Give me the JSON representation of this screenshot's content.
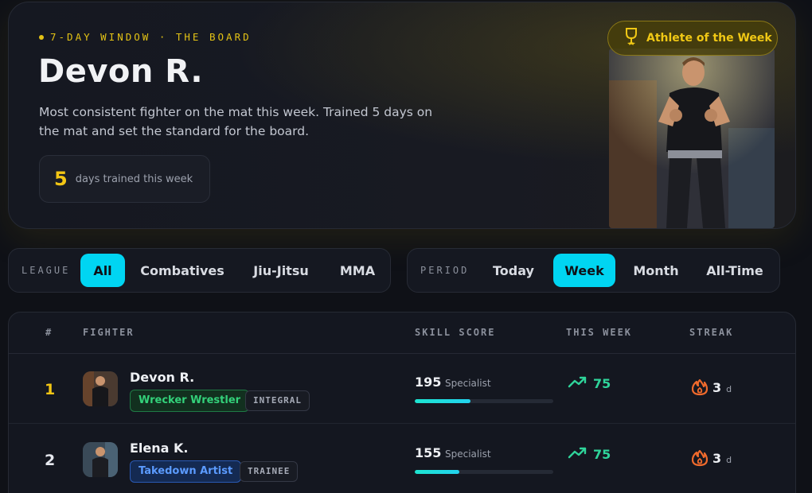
{
  "hero": {
    "eyebrow": "7-DAY WINDOW · THE BOARD",
    "name": "Devon R.",
    "description": "Most consistent fighter on the mat this week. Trained 5 days on the mat and set the standard for the board.",
    "days_value": "5",
    "days_label": "days trained this week",
    "badge_label": "Athlete of the Week",
    "badge_icon": "trophy-icon",
    "accent": "#e3c215"
  },
  "league_filter": {
    "label": "LEAGUE",
    "options": [
      "All",
      "Combatives",
      "Jiu-Jitsu",
      "MMA"
    ],
    "selected": "All"
  },
  "period_filter": {
    "label": "PERIOD",
    "options": [
      "Today",
      "Week",
      "Month",
      "All-Time"
    ],
    "selected": "Week"
  },
  "table": {
    "headers": [
      "#",
      "FIGHTER",
      "SKILL SCORE",
      "THIS WEEK",
      "STREAK"
    ],
    "rows": [
      {
        "rank": "1",
        "name": "Devon R.",
        "archetype": "Wrecker Wrestler",
        "tier": "INTEGRAL",
        "score": "195",
        "score_label": "Specialist",
        "score_progress": 0.4,
        "week": "75",
        "streak": "3",
        "streak_unit": "d"
      },
      {
        "rank": "2",
        "name": "Elena K.",
        "archetype": "Takedown Artist",
        "tier": "TRAINEE",
        "score": "155",
        "score_label": "Specialist",
        "score_progress": 0.32,
        "week": "75",
        "streak": "3",
        "streak_unit": "d"
      }
    ]
  },
  "colors": {
    "active_pill": "#00d5f2",
    "rank_gold": "#f3c614",
    "trend_green": "#2fd49a",
    "flame_orange": "#f06a2c"
  }
}
